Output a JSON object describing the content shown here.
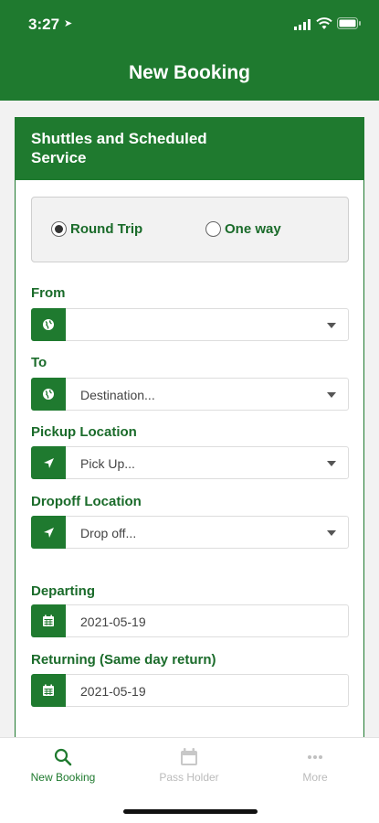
{
  "status_bar": {
    "time": "3:27"
  },
  "header": {
    "title": "New Booking"
  },
  "card": {
    "title": "Shuttles and Scheduled Service"
  },
  "trip_type": {
    "options": [
      {
        "label": "Round Trip",
        "selected": true
      },
      {
        "label": "One way",
        "selected": false
      }
    ]
  },
  "form": {
    "from": {
      "label": "From",
      "value": "",
      "icon": "globe-icon"
    },
    "to": {
      "label": "To",
      "value": "Destination...",
      "icon": "globe-icon"
    },
    "pickup": {
      "label": "Pickup Location",
      "value": "Pick Up...",
      "icon": "location-arrow-icon"
    },
    "dropoff": {
      "label": "Dropoff Location",
      "value": "Drop off...",
      "icon": "location-arrow-icon"
    },
    "departing": {
      "label": "Departing",
      "value": "2021-05-19",
      "icon": "calendar-icon"
    },
    "returning": {
      "label": "Returning (Same day return)",
      "value": "2021-05-19",
      "icon": "calendar-icon"
    }
  },
  "tabbar": {
    "items": [
      {
        "label": "New Booking",
        "icon": "search-icon",
        "active": true
      },
      {
        "label": "Pass Holder",
        "icon": "calendar-icon",
        "active": false
      },
      {
        "label": "More",
        "icon": "more-icon",
        "active": false
      }
    ]
  },
  "colors": {
    "brand_green": "#1f7a2f",
    "label_green": "#1a6b2a",
    "inactive_gray": "#bbbbbb"
  }
}
